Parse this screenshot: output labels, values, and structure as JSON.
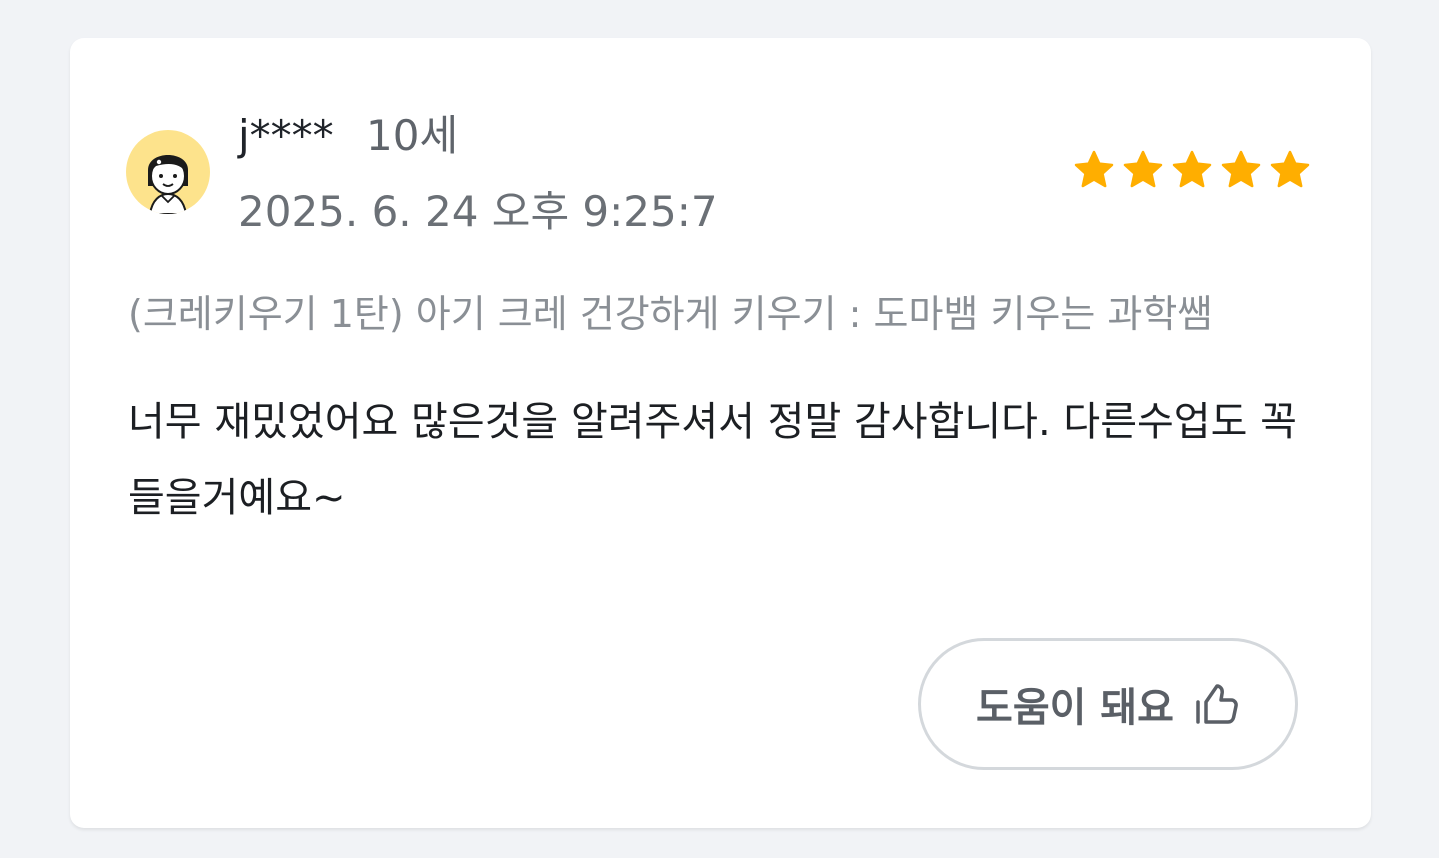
{
  "review": {
    "user_name": "j****",
    "user_age": "10세",
    "date": "2025. 6. 24 오후 9:25:7",
    "rating": 5,
    "rating_max": 5,
    "star_color": "#ffae00",
    "course_title": "(크레키우기 1탄) 아기 크레 건강하게 키우기 : 도마뱀 키우는 과학쌤",
    "body": "너무 재밌었어요 많은것을 알려주셔서 정말 감사합니다. 다른수업도 꼭 들을거예요~",
    "avatar_icon": "girl-avatar-icon",
    "helpful_label": "도움이 돼요",
    "helpful_icon": "thumbs-up-icon"
  }
}
